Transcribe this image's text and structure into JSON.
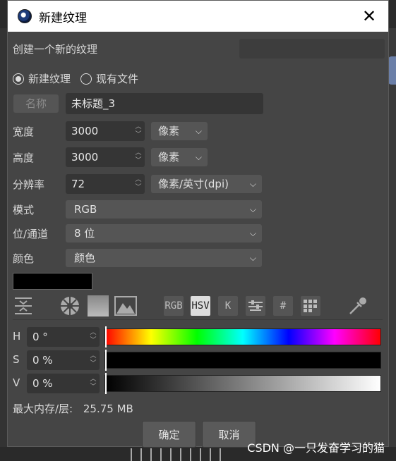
{
  "window": {
    "title": "新建纹理",
    "app_icon": "cinema4d-logo-icon"
  },
  "subtitle": "创建一个新的纹理",
  "source": {
    "options": [
      "新建纹理",
      "现有文件"
    ],
    "selected": "新建纹理"
  },
  "name": {
    "label": "名称",
    "value": "未标题_3"
  },
  "width": {
    "label": "宽度",
    "value": "3000",
    "unit": "像素"
  },
  "height": {
    "label": "高度",
    "value": "3000",
    "unit": "像素"
  },
  "resolution": {
    "label": "分辨率",
    "value": "72",
    "unit": "像素/英寸(dpi)"
  },
  "mode": {
    "label": "模式",
    "value": "RGB"
  },
  "bit_depth": {
    "label": "位/通道",
    "value": "8 位"
  },
  "color": {
    "label": "颜色",
    "value": "颜色",
    "swatch": "#000000"
  },
  "color_toolbar": {
    "tabs": [
      "RGB",
      "HSV",
      "K",
      "#"
    ],
    "active": "HSV"
  },
  "hsv": [
    {
      "label": "H",
      "value": "0 °"
    },
    {
      "label": "S",
      "value": "0 %"
    },
    {
      "label": "V",
      "value": "0 %"
    }
  ],
  "memory": {
    "label": "最大内存/层:",
    "value": "25.75 MB"
  },
  "buttons": {
    "ok": "确定",
    "cancel": "取消"
  },
  "watermark": "CSDN @一只发奋学习的猫"
}
